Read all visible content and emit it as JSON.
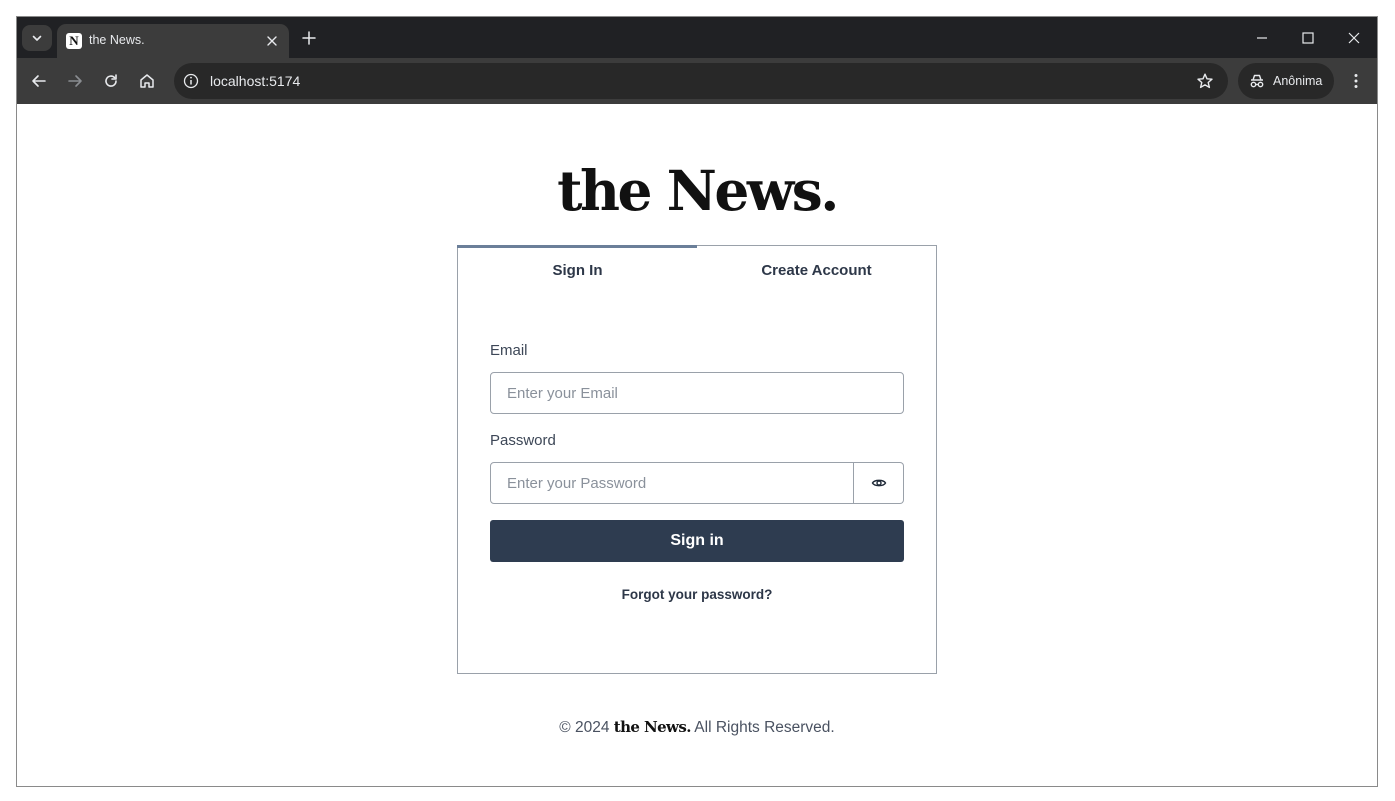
{
  "browser": {
    "tab_title": "the News.",
    "favicon_letter": "N",
    "url": "localhost:5174",
    "profile_label": "Anônima"
  },
  "page": {
    "logo": "the News.",
    "tabs": [
      {
        "label": "Sign In",
        "active": true
      },
      {
        "label": "Create Account",
        "active": false
      }
    ],
    "email": {
      "label": "Email",
      "placeholder": "Enter your Email",
      "value": ""
    },
    "password": {
      "label": "Password",
      "placeholder": "Enter your Password",
      "value": ""
    },
    "sign_in_button": "Sign in",
    "forgot_link": "Forgot your password?",
    "footer": {
      "prefix": "© 2024",
      "brand": "the News.",
      "suffix": "All Rights Reserved."
    }
  },
  "colors": {
    "browser_frame": "#202124",
    "toolbar": "#3c3c3c",
    "primary_button": "#2e3c50",
    "tab_indicator": "#6b7f99",
    "text_dark": "#2d3748"
  }
}
